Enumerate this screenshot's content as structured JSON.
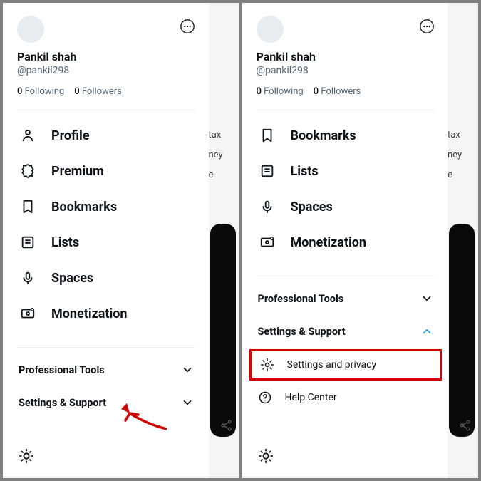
{
  "user": {
    "display_name": "Pankil shah",
    "handle": "@pankil298",
    "following_count": "0",
    "following_label": "Following",
    "followers_count": "0",
    "followers_label": "Followers"
  },
  "left_panel": {
    "menu": [
      {
        "id": "profile",
        "label": "Profile",
        "icon": "person-icon"
      },
      {
        "id": "premium",
        "label": "Premium",
        "icon": "badge-icon"
      },
      {
        "id": "bookmarks",
        "label": "Bookmarks",
        "icon": "bookmark-icon"
      },
      {
        "id": "lists",
        "label": "Lists",
        "icon": "list-icon"
      },
      {
        "id": "spaces",
        "label": "Spaces",
        "icon": "mic-icon"
      },
      {
        "id": "monetization",
        "label": "Monetization",
        "icon": "money-icon"
      }
    ],
    "sections": {
      "professional_tools": "Professional Tools",
      "settings_support": "Settings & Support"
    }
  },
  "right_panel": {
    "menu": [
      {
        "id": "bookmarks",
        "label": "Bookmarks",
        "icon": "bookmark-icon"
      },
      {
        "id": "lists",
        "label": "Lists",
        "icon": "list-icon"
      },
      {
        "id": "spaces",
        "label": "Spaces",
        "icon": "mic-icon"
      },
      {
        "id": "monetization",
        "label": "Monetization",
        "icon": "money-icon"
      }
    ],
    "sections": {
      "professional_tools": "Professional Tools",
      "settings_support": "Settings & Support"
    },
    "expanded": {
      "settings_privacy": "Settings and privacy",
      "help_center": "Help Center"
    }
  },
  "bg_text": {
    "line1": "tax",
    "line2": "ney",
    "line3": "e"
  },
  "colors": {
    "accent": "#1d9bf0",
    "highlight": "#d90000",
    "arrow": "#cc0000"
  }
}
